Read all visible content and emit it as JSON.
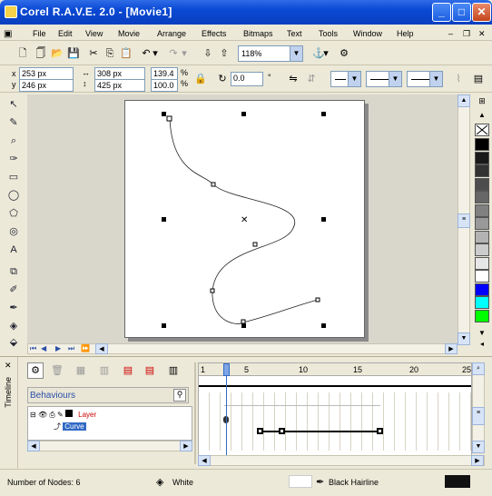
{
  "window": {
    "title": "Corel R.A.V.E. 2.0 - [Movie1]"
  },
  "menu": {
    "items": [
      "File",
      "Edit",
      "View",
      "Movie",
      "Arrange",
      "Effects",
      "Bitmaps",
      "Text",
      "Tools",
      "Window",
      "Help"
    ]
  },
  "toolbar": {
    "zoom_value": "118%"
  },
  "property_bar": {
    "x_value": "253 px",
    "y_value": "246 px",
    "w_value": "308 px",
    "h_value": "425 px",
    "scale_w": "139.4",
    "scale_h": "100.0",
    "scale_unit_w": "%",
    "scale_unit_h": "%",
    "rotation_value": "0.0",
    "degree_symbol": "°"
  },
  "timeline": {
    "panel_title": "Timeline",
    "behaviours_label": "Behaviours",
    "layer_label": "Layer",
    "curve_label": "Curve",
    "frame_ticks": [
      "1",
      "5",
      "10",
      "15",
      "20",
      "25"
    ],
    "current_frame": 5
  },
  "status": {
    "nodes": "Number of Nodes: 6",
    "fill": "White",
    "outline": "Black Hairline"
  },
  "colors": {
    "titlebar": "#0a49d4",
    "selection": "#316ac5",
    "palette": [
      "#000000",
      "#1a1a1a",
      "#333333",
      "#4d4d4d",
      "#666666",
      "#808080",
      "#999999",
      "#b3b3b3",
      "#cccccc",
      "#e6e6e6",
      "#ffffff",
      "#0000ff",
      "#00ffff",
      "#00ff00"
    ]
  }
}
